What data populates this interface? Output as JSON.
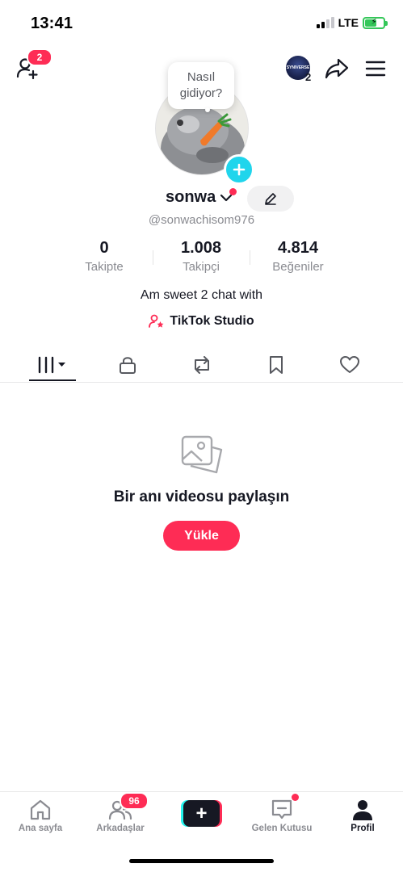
{
  "status_bar": {
    "time": "13:41",
    "network": "LTE"
  },
  "top_bar": {
    "friend_requests_badge": "2",
    "account_count": "2",
    "account_avatar_text": "SYNIVERSE"
  },
  "profile": {
    "bubble_line1": "Nasıl",
    "bubble_line2": "gidiyor?",
    "username": "sonwa",
    "handle": "@sonwachisom976",
    "stats": [
      {
        "value": "0",
        "label": "Takipte"
      },
      {
        "value": "1.008",
        "label": "Takipçi"
      },
      {
        "value": "4.814",
        "label": "Beğeniler"
      }
    ],
    "bio": "Am sweet 2 chat with",
    "studio_link": "TikTok Studio"
  },
  "tabs": [
    "videos",
    "private",
    "reposts",
    "favorites",
    "liked"
  ],
  "empty_state": {
    "title": "Bir anı videosu paylaşın",
    "button": "Yükle"
  },
  "bottom_nav": {
    "home": "Ana sayfa",
    "friends": "Arkadaşlar",
    "friends_badge": "96",
    "inbox": "Gelen Kutusu",
    "profile": "Profil",
    "create": "+"
  },
  "colors": {
    "accent": "#fe2c55",
    "cyan": "#20d5ec",
    "text": "#161823",
    "muted": "#8a8b91"
  }
}
